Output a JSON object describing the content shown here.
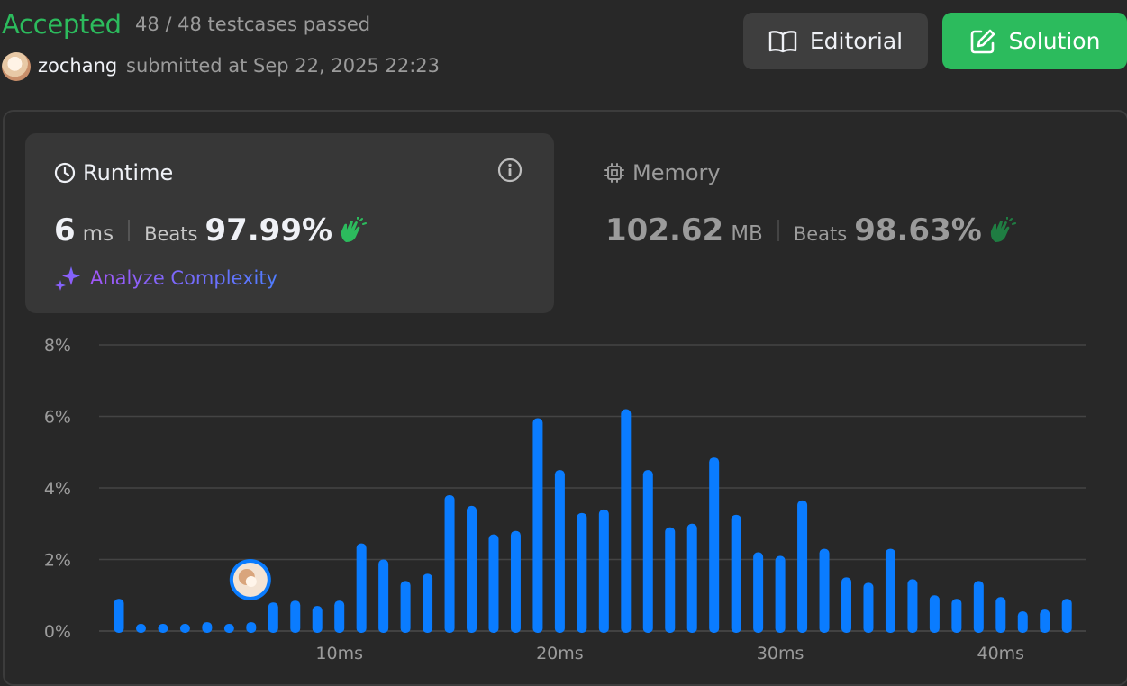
{
  "header": {
    "status": "Accepted",
    "testcases": "48 / 48 testcases passed",
    "username": "zochang",
    "submitted": "submitted at Sep 22, 2025 22:23",
    "editorial_label": "Editorial",
    "solution_label": "Solution"
  },
  "runtime": {
    "title": "Runtime",
    "value": "6",
    "unit": "ms",
    "beats_label": "Beats",
    "beats_value": "97.99%",
    "analyze_label": "Analyze Complexity"
  },
  "memory": {
    "title": "Memory",
    "value": "102.62",
    "unit": "MB",
    "beats_label": "Beats",
    "beats_value": "98.63%"
  },
  "colors": {
    "accepted": "#2cbb5d",
    "bar": "#0a7cff",
    "clap": "#2cbb5d",
    "analyze_gradient_start": "#a156f5",
    "analyze_gradient_end": "#4f7dff"
  },
  "chart_data": {
    "type": "bar",
    "title": "",
    "ylim": [
      0,
      8
    ],
    "yticks": [
      "0%",
      "2%",
      "4%",
      "6%",
      "8%"
    ],
    "xticks": [
      "10ms",
      "20ms",
      "30ms",
      "40ms"
    ],
    "grid": true,
    "categories": [
      0,
      1,
      2,
      3,
      4,
      5,
      6,
      7,
      8,
      9,
      10,
      11,
      12,
      13,
      14,
      15,
      16,
      17,
      18,
      19,
      20,
      21,
      22,
      23,
      24,
      25,
      26,
      27,
      28,
      29,
      30,
      31,
      32,
      33,
      34,
      35,
      36,
      37,
      38,
      39,
      40,
      41,
      42,
      43
    ],
    "values": [
      0.9,
      0.2,
      0.2,
      0.2,
      0.25,
      0.2,
      0.25,
      0.8,
      0.85,
      0.7,
      0.85,
      2.45,
      2.0,
      1.4,
      1.6,
      3.8,
      3.5,
      2.7,
      2.8,
      5.95,
      4.5,
      3.3,
      3.4,
      6.2,
      4.5,
      2.9,
      3.0,
      4.85,
      3.25,
      2.2,
      2.1,
      3.65,
      2.3,
      1.5,
      1.35,
      2.3,
      1.45,
      1.0,
      0.9,
      1.4,
      0.95,
      0.55,
      0.6,
      0.9
    ],
    "user_bar_index": 6
  }
}
